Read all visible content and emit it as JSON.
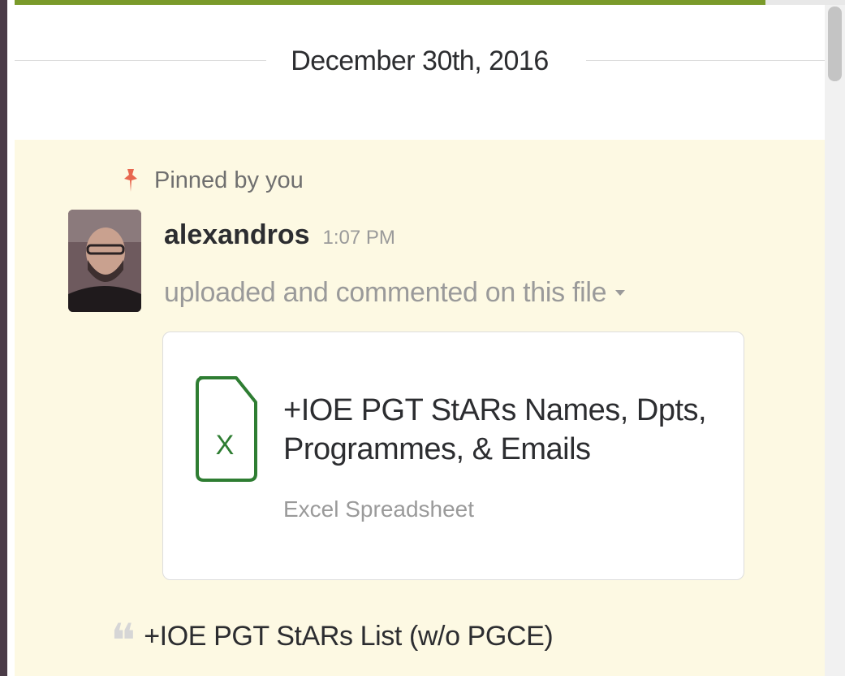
{
  "date_divider": "December 30th, 2016",
  "pin": {
    "text": "Pinned by you",
    "icon": "pin-icon"
  },
  "message": {
    "sender": "alexandros",
    "time": "1:07 PM",
    "action": "uploaded and commented on this file"
  },
  "file": {
    "icon": "excel-file-icon",
    "icon_letter": "X",
    "title": "+IOE PGT StARs Names, Dpts, Programmes, & Emails",
    "type": "Excel Spreadsheet"
  },
  "comment": {
    "icon": "quote-icon",
    "text": "+IOE PGT StARs List (w/o PGCE)"
  },
  "colors": {
    "accent": "#7a9a2a",
    "pinned_bg": "#fdf9e3",
    "pin_red": "#e8674f",
    "excel_green": "#2e7d32"
  }
}
